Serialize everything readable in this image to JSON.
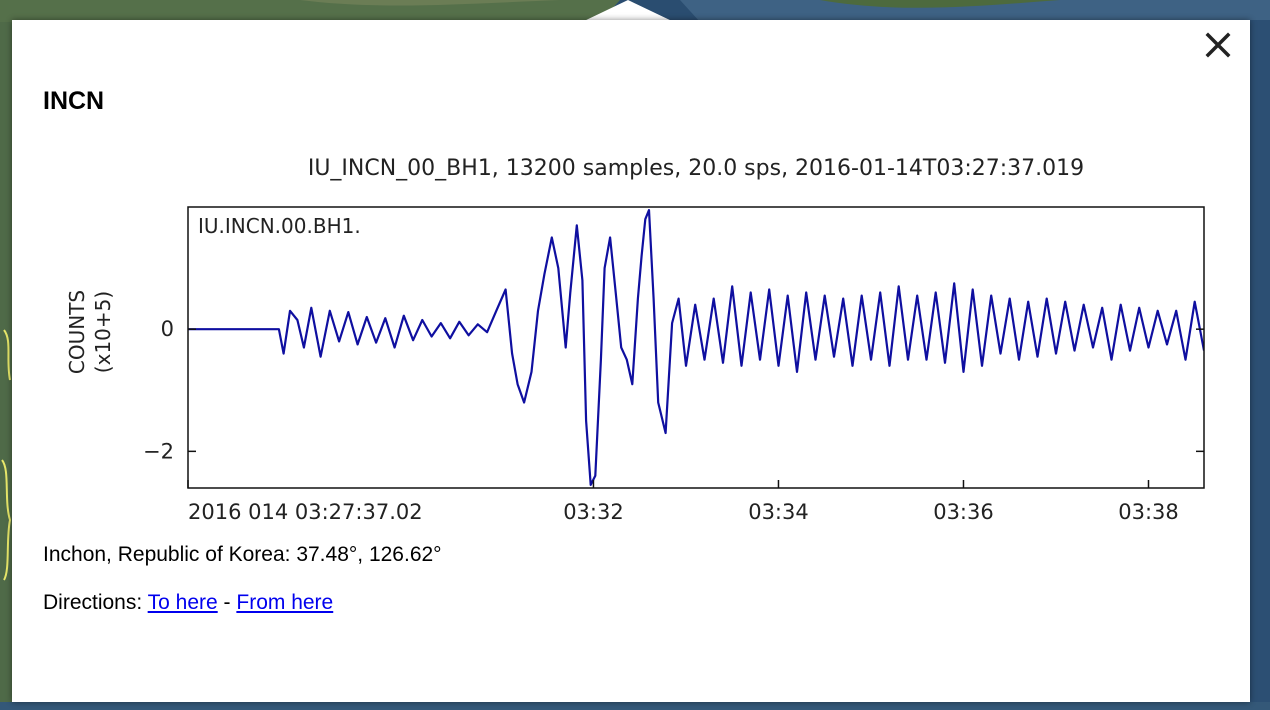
{
  "balloon": {
    "title": "INCN",
    "close_icon": "close-icon",
    "location_text": "Inchon, Republic of Korea: 37.48°, 126.62°",
    "directions": {
      "prefix": "Directions: ",
      "to_here": "To here",
      "separator": " - ",
      "from_here": "From here"
    }
  },
  "chart_data": {
    "type": "line",
    "title": "IU_INCN_00_BH1, 13200 samples, 20.0 sps, 2016-01-14T03:27:37.019",
    "inset_label": "IU.INCN.00.BH1.",
    "ylabel": "COUNTS",
    "ylabel_units": "(x10+5)",
    "xlim_minutes": [
      27.617,
      38.6
    ],
    "ylim": [
      -2.6,
      2.0
    ],
    "y_ticks": [
      {
        "value": 0,
        "label": "0"
      },
      {
        "value": -2,
        "label": "−2"
      }
    ],
    "x_ticks": [
      {
        "minutes": 27.617,
        "label": "2016 014 03:27:37.02"
      },
      {
        "minutes": 32,
        "label": "03:32"
      },
      {
        "minutes": 34,
        "label": "03:34"
      },
      {
        "minutes": 36,
        "label": "03:36"
      },
      {
        "minutes": 38,
        "label": "03:38"
      }
    ],
    "series": [
      {
        "color": "#0f0fa0",
        "x": [
          27.617,
          28.4,
          28.6,
          28.65,
          28.72,
          28.8,
          28.87,
          28.95,
          29.05,
          29.15,
          29.25,
          29.35,
          29.45,
          29.55,
          29.65,
          29.75,
          29.85,
          29.95,
          30.05,
          30.15,
          30.25,
          30.35,
          30.45,
          30.55,
          30.65,
          30.75,
          30.85,
          30.95,
          31.05,
          31.12,
          31.18,
          31.25,
          31.33,
          31.4,
          31.47,
          31.55,
          31.62,
          31.7,
          31.75,
          31.82,
          31.88,
          31.92,
          31.97,
          32.02,
          32.08,
          32.12,
          32.18,
          32.24,
          32.3,
          32.36,
          32.42,
          32.48,
          32.52,
          32.56,
          32.6,
          32.65,
          32.7,
          32.78,
          32.85,
          32.92,
          33.0,
          33.1,
          33.2,
          33.3,
          33.4,
          33.5,
          33.6,
          33.7,
          33.8,
          33.9,
          34.0,
          34.1,
          34.2,
          34.3,
          34.4,
          34.5,
          34.6,
          34.7,
          34.8,
          34.9,
          35.0,
          35.1,
          35.2,
          35.3,
          35.4,
          35.5,
          35.6,
          35.7,
          35.8,
          35.9,
          36.0,
          36.1,
          36.2,
          36.3,
          36.4,
          36.5,
          36.6,
          36.7,
          36.8,
          36.9,
          37.0,
          37.1,
          37.2,
          37.3,
          37.4,
          37.5,
          37.6,
          37.7,
          37.8,
          37.9,
          38.0,
          38.1,
          38.2,
          38.3,
          38.4,
          38.5,
          38.6
        ],
        "y": [
          0,
          0,
          0,
          -0.4,
          0.3,
          0.15,
          -0.3,
          0.35,
          -0.45,
          0.3,
          -0.2,
          0.28,
          -0.25,
          0.2,
          -0.22,
          0.18,
          -0.3,
          0.22,
          -0.18,
          0.15,
          -0.12,
          0.1,
          -0.15,
          0.12,
          -0.1,
          0.08,
          -0.05,
          0.3,
          0.65,
          -0.4,
          -0.9,
          -1.2,
          -0.7,
          0.3,
          0.9,
          1.5,
          1.0,
          -0.3,
          0.6,
          1.7,
          0.8,
          -1.5,
          -2.55,
          -2.4,
          -0.5,
          1.0,
          1.5,
          0.6,
          -0.3,
          -0.5,
          -0.9,
          0.5,
          1.2,
          1.8,
          1.95,
          0.5,
          -1.2,
          -1.7,
          0.1,
          0.5,
          -0.6,
          0.4,
          -0.5,
          0.5,
          -0.55,
          0.7,
          -0.6,
          0.6,
          -0.5,
          0.65,
          -0.6,
          0.55,
          -0.7,
          0.6,
          -0.5,
          0.55,
          -0.45,
          0.5,
          -0.6,
          0.55,
          -0.5,
          0.6,
          -0.6,
          0.7,
          -0.5,
          0.55,
          -0.5,
          0.6,
          -0.55,
          0.75,
          -0.7,
          0.65,
          -0.6,
          0.55,
          -0.4,
          0.5,
          -0.5,
          0.45,
          -0.45,
          0.5,
          -0.4,
          0.45,
          -0.35,
          0.4,
          -0.3,
          0.35,
          -0.5,
          0.4,
          -0.35,
          0.35,
          -0.3,
          0.3,
          -0.25,
          0.3,
          -0.5,
          0.45,
          -0.35
        ]
      }
    ]
  }
}
